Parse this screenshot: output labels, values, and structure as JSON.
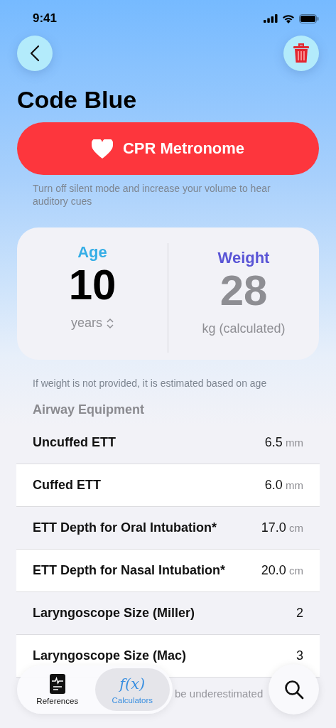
{
  "status_bar": {
    "time": "9:41"
  },
  "title": "Code Blue",
  "metronome_button": {
    "label": "CPR Metronome"
  },
  "metronome_note": "Turn off silent mode and increase your volume to hear auditory cues",
  "patient": {
    "age": {
      "label": "Age",
      "value": "10",
      "unit": "years"
    },
    "weight": {
      "label": "Weight",
      "value": "28",
      "unit": "kg (calculated)"
    }
  },
  "weight_note": "If weight is not provided, it is estimated based on age",
  "section": {
    "title": "Airway Equipment",
    "rows": [
      {
        "label": "Uncuffed ETT",
        "value": "6.5",
        "unit": "mm"
      },
      {
        "label": "Cuffed ETT",
        "value": "6.0",
        "unit": "mm"
      },
      {
        "label": "ETT Depth for Oral Intubation*",
        "value": "17.0",
        "unit": "cm"
      },
      {
        "label": "ETT Depth for Nasal Intubation*",
        "value": "20.0",
        "unit": "cm"
      },
      {
        "label": "Laryngoscope Size (Miller)",
        "value": "2"
      },
      {
        "label": "Laryngoscope Size (Mac)",
        "value": "3"
      }
    ],
    "footnote": "be underestimated"
  },
  "tab_bar": [
    {
      "kind": "references",
      "label": "References",
      "selected": false
    },
    {
      "kind": "calculators",
      "icon_text": "f(x)",
      "label": "Calculators",
      "selected": true
    }
  ]
}
